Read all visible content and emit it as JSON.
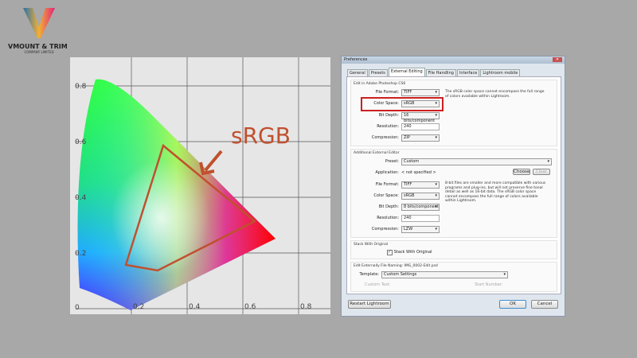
{
  "logo": {
    "name": "VMOUNT & TRIM",
    "sub": "COMPANY LIMITED"
  },
  "chart": {
    "label": "sRGB",
    "y_ticks": [
      "0.8",
      "0.6",
      "0.4",
      "0.2",
      "0"
    ],
    "x_ticks": [
      "0.2",
      "0.4",
      "0.6",
      "0.8"
    ],
    "annotation_color": "#c0502e"
  },
  "dialog": {
    "title": "Preferences",
    "tabs": [
      "General",
      "Presets",
      "External Editing",
      "File Handling",
      "Interface",
      "Lightroom mobile"
    ],
    "active_tab": "External Editing",
    "photoshop": {
      "heading": "Edit in Adobe Photoshop CS6",
      "file_format_label": "File Format:",
      "file_format": "TIFF",
      "color_space_label": "Color Space:",
      "color_space": "sRGB",
      "bit_depth_label": "Bit Depth:",
      "bit_depth": "16 bits/component",
      "resolution_label": "Resolution:",
      "resolution": "240",
      "compression_label": "Compression:",
      "compression": "ZIP",
      "note": "The sRGB color space cannot encompass the full range of colors available within Lightroom."
    },
    "additional": {
      "heading": "Additional External Editor",
      "preset_label": "Preset:",
      "preset": "Custom",
      "application_label": "Application:",
      "application": "< not specified >",
      "choose": "Choose",
      "clear": "Clear",
      "file_format_label": "File Format:",
      "file_format": "TIFF",
      "color_space_label": "Color Space:",
      "color_space": "sRGB",
      "bit_depth_label": "Bit Depth:",
      "bit_depth": "8 bits/component",
      "resolution_label": "Resolution:",
      "resolution": "240",
      "compression_label": "Compression:",
      "compression": "LZW",
      "note": "8-bit files are smaller and more compatible with various programs and plug-ins, but will not preserve fine tonal detail as well as 16-bit data. The sRGB color space cannot encompass the full range of colors available within Lightroom."
    },
    "stack": {
      "heading": "Stack With Original",
      "checkbox": "Stack With Original",
      "checked": true
    },
    "naming": {
      "heading": "Edit Externally File Naming:",
      "example": "IMG_0002-Edit.psd",
      "template_label": "Template:",
      "template": "Custom Settings",
      "custom_text_label": "Custom Text:",
      "start_number_label": "Start Number:"
    },
    "restart": "Restart Lightroom",
    "ok": "OK",
    "cancel": "Cancel"
  }
}
